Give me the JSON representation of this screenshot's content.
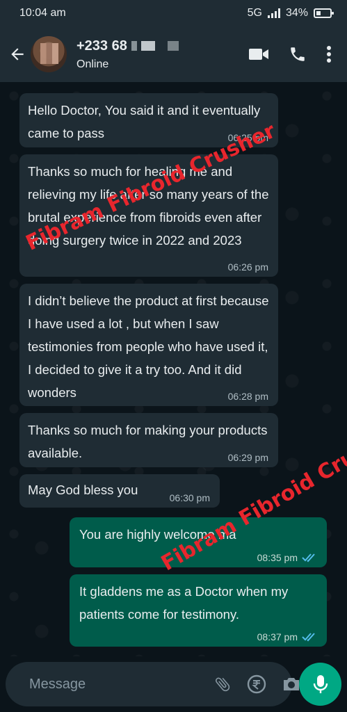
{
  "status_bar": {
    "time": "10:04 am",
    "network": "5G",
    "battery": "34%"
  },
  "header": {
    "contact_name": "+233 68",
    "contact_status": "Online"
  },
  "messages": [
    {
      "direction": "in",
      "text": "Hello Doctor, You said it and it eventually came to pass",
      "time": "06:25 pm"
    },
    {
      "direction": "in",
      "text": "Thanks so much for healing me and relieving my life after so many years of the brutal experience from fibroids even after doing surgery twice in 2022 and 2023",
      "time": "06:26 pm"
    },
    {
      "direction": "in",
      "text": "I didn’t believe the product at first because I have used a lot , but when I saw testimonies from people who have used it, I decided to give it a try too. And it did wonders",
      "time": "06:28 pm"
    },
    {
      "direction": "in",
      "text": "Thanks so much for making your products available.",
      "time": "06:29 pm"
    },
    {
      "direction": "in",
      "text": "May God bless you",
      "time": "06:30 pm"
    },
    {
      "direction": "out",
      "text": "You are highly welcome ma",
      "time": "08:35 pm",
      "receipt": "read"
    },
    {
      "direction": "out",
      "text": "It gladdens me as a Doctor when my patients come for testimony.",
      "time": "08:37 pm",
      "receipt": "read"
    }
  ],
  "watermarks": [
    "Fibram Fibroid Crusher",
    "Fibram Fibroid Crush"
  ],
  "composer": {
    "placeholder": "Message"
  },
  "colors": {
    "header_bg": "#1f2c34",
    "chat_bg": "#0b141a",
    "incoming_bubble": "#1f2c34",
    "outgoing_bubble": "#005c4b",
    "accent": "#00a884",
    "read_tick": "#53bdeb",
    "watermark": "#e8262d"
  },
  "icons": [
    "back-arrow-icon",
    "video-call-icon",
    "voice-call-icon",
    "more-options-icon",
    "emoji-icon",
    "attach-icon",
    "rupee-payment-icon",
    "camera-icon",
    "mic-icon",
    "double-check-icon"
  ]
}
